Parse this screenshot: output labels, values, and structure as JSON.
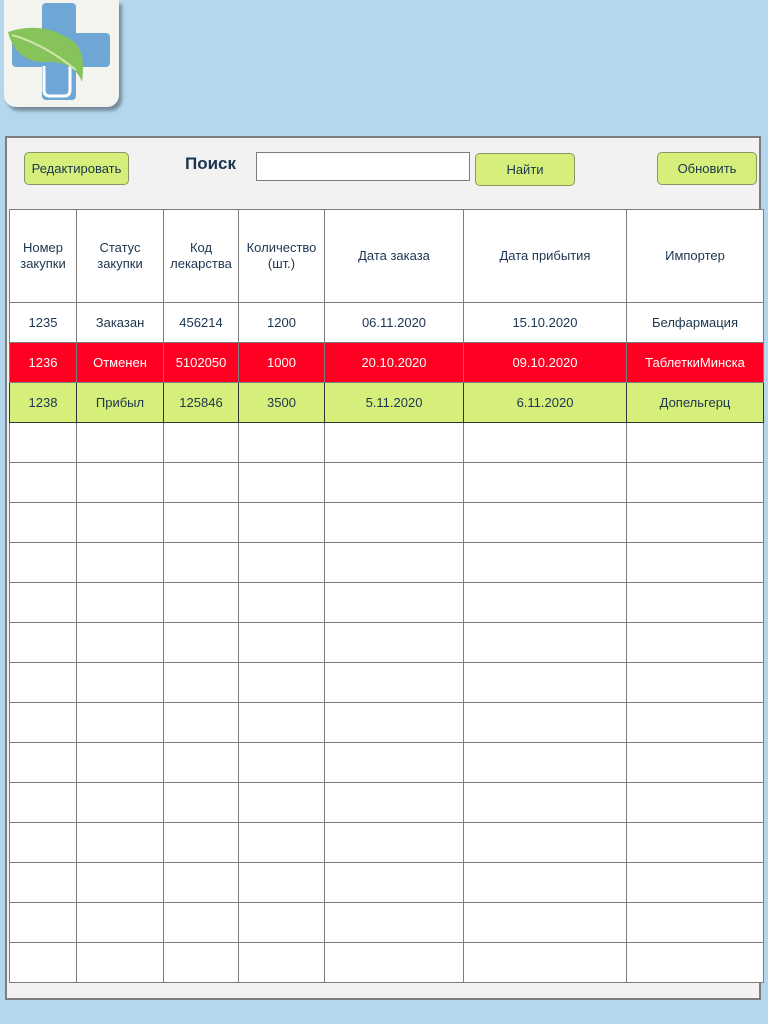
{
  "colors": {
    "background": "#b4d7ee",
    "button": "#d6ef7a",
    "row_cancelled": "#ff0022",
    "row_arrived": "#d6ef7a",
    "text": "#1b3550"
  },
  "logo": {
    "icon": "pharmacy-cross-leaf-icon"
  },
  "toolbar": {
    "edit_label": "Редактировать",
    "search_label": "Поиск",
    "search_value": "",
    "find_label": "Найти",
    "refresh_label": "Обновить"
  },
  "table": {
    "headers": [
      "Номер закупки",
      "Статус закупки",
      "Код лекарства",
      "Количество (шт.)",
      "Дата заказа",
      "Дата прибытия",
      "Импортер"
    ],
    "rows": [
      {
        "status_style": "ordered",
        "cells": [
          "1235",
          "Заказан",
          "456214",
          "1200",
          "06.11.2020",
          "15.10.2020",
          "Белфармация"
        ]
      },
      {
        "status_style": "cancelled",
        "cells": [
          "1236",
          "Отменен",
          "5102050",
          "1000",
          "20.10.2020",
          "09.10.2020",
          "ТаблеткиМинска"
        ]
      },
      {
        "status_style": "arrived",
        "cells": [
          "1238",
          "Прибыл",
          "125846",
          "3500",
          "5.11.2020",
          "6.11.2020",
          "Допельгерц"
        ]
      },
      {
        "status_style": "empty",
        "cells": [
          "",
          "",
          "",
          "",
          "",
          "",
          ""
        ]
      },
      {
        "status_style": "empty",
        "cells": [
          "",
          "",
          "",
          "",
          "",
          "",
          ""
        ]
      },
      {
        "status_style": "empty",
        "cells": [
          "",
          "",
          "",
          "",
          "",
          "",
          ""
        ]
      },
      {
        "status_style": "empty",
        "cells": [
          "",
          "",
          "",
          "",
          "",
          "",
          ""
        ]
      },
      {
        "status_style": "empty",
        "cells": [
          "",
          "",
          "",
          "",
          "",
          "",
          ""
        ]
      },
      {
        "status_style": "empty",
        "cells": [
          "",
          "",
          "",
          "",
          "",
          "",
          ""
        ]
      },
      {
        "status_style": "empty",
        "cells": [
          "",
          "",
          "",
          "",
          "",
          "",
          ""
        ]
      },
      {
        "status_style": "empty",
        "cells": [
          "",
          "",
          "",
          "",
          "",
          "",
          ""
        ]
      },
      {
        "status_style": "empty",
        "cells": [
          "",
          "",
          "",
          "",
          "",
          "",
          ""
        ]
      },
      {
        "status_style": "empty",
        "cells": [
          "",
          "",
          "",
          "",
          "",
          "",
          ""
        ]
      },
      {
        "status_style": "empty",
        "cells": [
          "",
          "",
          "",
          "",
          "",
          "",
          ""
        ]
      },
      {
        "status_style": "empty",
        "cells": [
          "",
          "",
          "",
          "",
          "",
          "",
          ""
        ]
      },
      {
        "status_style": "empty",
        "cells": [
          "",
          "",
          "",
          "",
          "",
          "",
          ""
        ]
      },
      {
        "status_style": "empty",
        "cells": [
          "",
          "",
          "",
          "",
          "",
          "",
          ""
        ]
      }
    ]
  }
}
